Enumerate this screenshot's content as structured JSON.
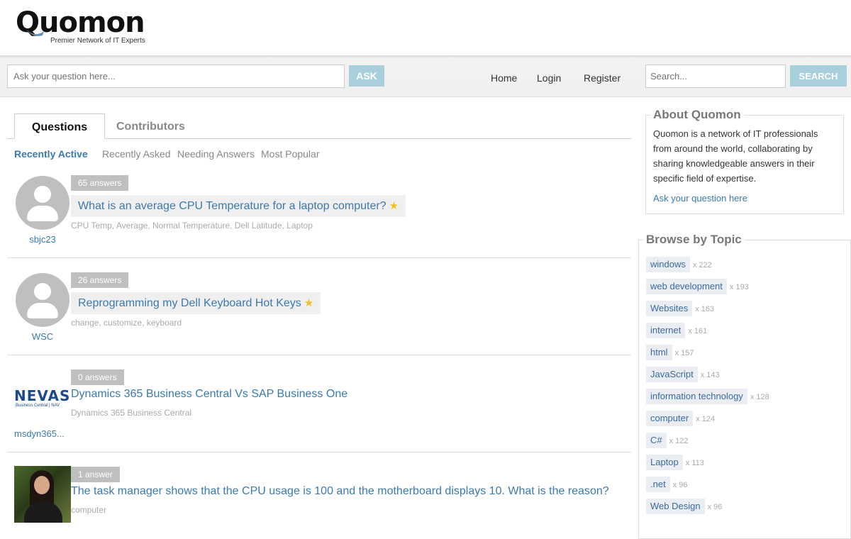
{
  "logo": {
    "name": "Quomon",
    "tagline": "Premier Network of IT Experts"
  },
  "toolbar": {
    "ask_placeholder": "Ask your question here...",
    "ask_label": "ASK",
    "nav": [
      "Home",
      "Login",
      "Register"
    ],
    "search_placeholder": "Search...",
    "search_label": "SEARCH"
  },
  "tabs": {
    "active": "Questions",
    "inactive": "Contributors"
  },
  "filters": [
    "Recently Active",
    "Recently Asked",
    "Needing Answers",
    "Most Popular"
  ],
  "questions": [
    {
      "answers": "65 answers",
      "title": "What is an average CPU Temperature for a laptop computer?",
      "starred": true,
      "tags": [
        "CPU Temp",
        "Average",
        "Normal Temperature",
        "Dell Latitude",
        "Laptop"
      ],
      "user": "sbjc23"
    },
    {
      "answers": "26 answers",
      "title": "Reprogramming my Dell Keyboard Hot Keys",
      "starred": true,
      "tags": [
        "change",
        "customize",
        "keyboard"
      ],
      "user": "WSC"
    },
    {
      "answers": "0 answers",
      "title": "Dynamics 365 Business Central Vs SAP Business One",
      "starred": false,
      "tags": [
        "Dynamics 365 Business Central"
      ],
      "user": "msdyn365...",
      "logo_main": "NEVAS",
      "logo_sub": "Business Central | NAV"
    },
    {
      "answers": "1 answer",
      "title": "The task manager shows that the CPU usage is 100 and the motherboard displays 10. What is the reason?",
      "starred": false,
      "tags": [
        "computer"
      ],
      "user": ""
    }
  ],
  "about": {
    "title": "About Quomon",
    "text": "Quomon is a network of IT professionals from around the world, collaborating by sharing knowledgeable answers in their specific field of expertise.",
    "link": "Ask your question here"
  },
  "topics": {
    "title": "Browse by Topic",
    "items": [
      {
        "name": "windows",
        "count": "x 222"
      },
      {
        "name": "web development",
        "count": "x 193"
      },
      {
        "name": "Websites",
        "count": "x 163"
      },
      {
        "name": "internet",
        "count": "x 161"
      },
      {
        "name": "html",
        "count": "x 157"
      },
      {
        "name": "JavaScript",
        "count": "x 143"
      },
      {
        "name": "information technology",
        "count": "x 128"
      },
      {
        "name": "computer",
        "count": "x 124"
      },
      {
        "name": "C#",
        "count": "x 122"
      },
      {
        "name": "Laptop",
        "count": "x 113"
      },
      {
        "name": ".net",
        "count": "x 96"
      },
      {
        "name": "Web Design",
        "count": "x 96"
      }
    ]
  },
  "colors": {
    "accent_button": "#a9cfdd",
    "link": "#3a7ab0",
    "badge": "#bfbfbf",
    "star": "#f0c020"
  }
}
